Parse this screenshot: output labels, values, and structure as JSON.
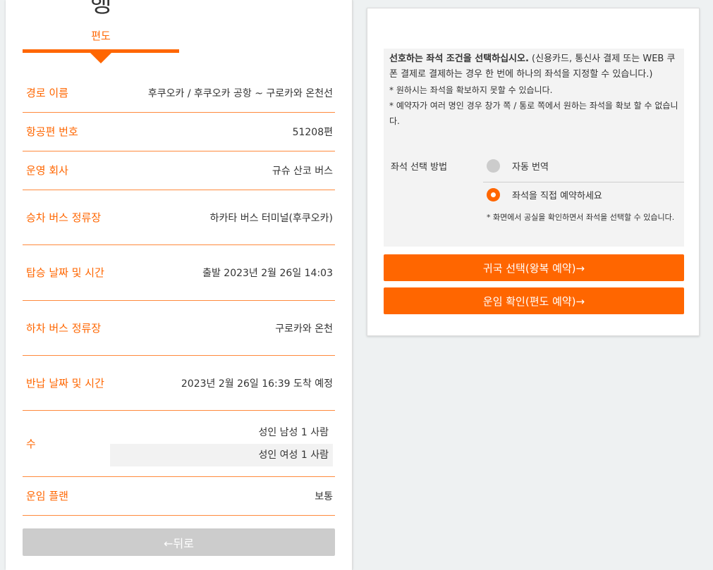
{
  "header": {
    "title": "행",
    "subtitle": "편도"
  },
  "details": {
    "route_label": "경로 이름",
    "route_value": "후쿠오카 / 후쿠오카 공항 ~ 구로카와 온천선",
    "flight_label": "항공편 번호",
    "flight_value": "51208편",
    "operator_label": "운영 회사",
    "operator_value": "규슈 산코 버스",
    "boarding_stop_label": "승차 버스 정류장",
    "boarding_stop_value": "하카타 버스 터미널(후쿠오카)",
    "departure_label": "탑승 날짜 및 시간",
    "departure_value": "출발 2023년 2월 26일 14:03",
    "alighting_stop_label": "하차 버스 정류장",
    "alighting_stop_value": "구로카와 온천",
    "return_label": "반납 날짜 및 시간",
    "return_value": "2023년 2월 26일 16:39 도착 예정",
    "count_label": "수",
    "count_values": [
      "성인 남성 1 사람",
      "성인 여성 1 사람"
    ],
    "fare_plan_label": "운임 플랜",
    "fare_plan_value": "보통"
  },
  "back_button": "←뒤로",
  "seat": {
    "instruction_bold": "선호하는 좌석 조건을 선택하십시오.",
    "instruction_rest": " (신용카드, 통신사 결제 또는 WEB 쿠폰 결제로 결제하는 경우 한 번에 하나의 좌석을 지정할 수 있습니다.)",
    "note1": "* 원하시는 좌석을 확보하지 못할 수 있습니다.",
    "note2": "* 예약자가 여러 명인 경우 창가 쪽 / 통로 쪽에서 원하는 좌석을 확보 할 수 없습니다.",
    "method_label": "좌석 선택 방법",
    "option_auto": "자동 번역",
    "option_manual": "좌석을 직접 예약하세요",
    "option_manual_note": "* 화면에서 공실을 확인하면서 좌석을 선택할 수 있습니다.",
    "selected_option": "option_manual"
  },
  "buttons": {
    "return_select": "귀국 선택(왕복 예약)→",
    "fare_confirm": "운임 확인(편도 예약)→"
  },
  "colors": {
    "accent": "#ff6600",
    "disabled": "#cccccc"
  }
}
